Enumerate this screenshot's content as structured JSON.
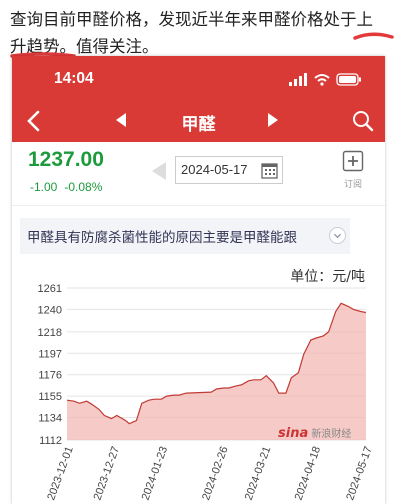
{
  "caption": {
    "line1": "查询目前甲醛价格，发现近半年来甲醛价格处于上",
    "line2": "升趋势。值得关注。"
  },
  "status_bar": {
    "time": "14:04"
  },
  "nav": {
    "title": "甲醛"
  },
  "quote": {
    "price": "1237.00",
    "change": "-1.00",
    "change_pct": "-0.08%",
    "date": "2024-05-17",
    "subscribe_label": "订阅"
  },
  "reason_banner": "甲醛具有防腐杀菌性能的原因主要是甲醛能跟",
  "chart_unit": "单位：元/吨",
  "watermark": {
    "logo": "sina",
    "text": "新浪财经"
  },
  "colors": {
    "nav_red": "#d93a36",
    "price_green": "#1d9b3c",
    "area_fill": "#f2b8b4",
    "line": "#c23a35"
  },
  "chart_data": {
    "type": "area",
    "title": "",
    "ylabel": "",
    "xlabel": "",
    "ylim": [
      1112,
      1261
    ],
    "yticks": [
      1261,
      1240,
      1218,
      1197,
      1176,
      1155,
      1134,
      1112
    ],
    "xticks": [
      "2023-12-01",
      "2023-12-27",
      "2024-01-23",
      "2024-02-26",
      "2024-03-21",
      "2024-04-18",
      "2024-05-17"
    ],
    "x": [
      "2023-12-01",
      "2023-12-05",
      "2023-12-08",
      "2023-12-12",
      "2023-12-15",
      "2023-12-19",
      "2023-12-22",
      "2023-12-26",
      "2023-12-29",
      "2024-01-03",
      "2024-01-05",
      "2024-01-09",
      "2024-01-12",
      "2024-01-16",
      "2024-01-19",
      "2024-01-23",
      "2024-01-26",
      "2024-01-30",
      "2024-02-02",
      "2024-02-06",
      "2024-02-20",
      "2024-02-23",
      "2024-02-27",
      "2024-03-01",
      "2024-03-05",
      "2024-03-08",
      "2024-03-12",
      "2024-03-15",
      "2024-03-19",
      "2024-03-22",
      "2024-03-26",
      "2024-03-29",
      "2024-04-02",
      "2024-04-05",
      "2024-04-09",
      "2024-04-12",
      "2024-04-16",
      "2024-04-19",
      "2024-04-23",
      "2024-04-26",
      "2024-04-30",
      "2024-05-03",
      "2024-05-07",
      "2024-05-10",
      "2024-05-14",
      "2024-05-17"
    ],
    "series": [
      {
        "values": [
          1151,
          1150,
          1148,
          1150,
          1147,
          1142,
          1136,
          1133,
          1136,
          1131,
          1128,
          1131,
          1148,
          1151,
          1152,
          1152,
          1155,
          1156,
          1156,
          1158,
          1159,
          1162,
          1163,
          1163,
          1165,
          1166,
          1170,
          1171,
          1171,
          1175,
          1168,
          1158,
          1158,
          1173,
          1178,
          1196,
          1210,
          1212,
          1214,
          1218,
          1238,
          1246,
          1243,
          1240,
          1238,
          1237
        ]
      }
    ]
  }
}
